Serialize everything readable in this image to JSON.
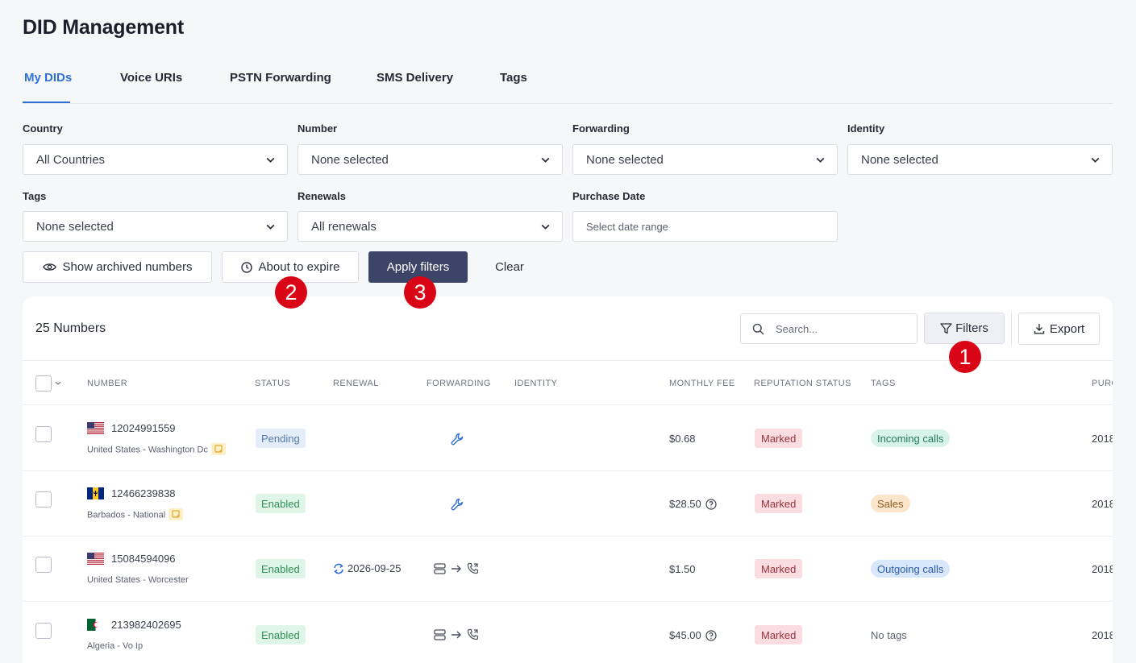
{
  "page_title": "DID Management",
  "tabs": [
    {
      "label": "My DIDs",
      "active": true
    },
    {
      "label": "Voice URIs"
    },
    {
      "label": "PSTN Forwarding"
    },
    {
      "label": "SMS Delivery"
    },
    {
      "label": "Tags"
    }
  ],
  "filters": {
    "country": {
      "label": "Country",
      "value": "All Countries"
    },
    "number": {
      "label": "Number",
      "value": "None selected"
    },
    "forwarding": {
      "label": "Forwarding",
      "value": "None selected"
    },
    "identity": {
      "label": "Identity",
      "value": "None selected"
    },
    "tags": {
      "label": "Tags",
      "value": "None selected"
    },
    "renewals": {
      "label": "Renewals",
      "value": "All renewals"
    },
    "purchase_date": {
      "label": "Purchase Date",
      "placeholder": "Select date range"
    }
  },
  "actions": {
    "show_archived": "Show archived numbers",
    "about_to_expire": "About to expire",
    "apply_filters": "Apply filters",
    "clear": "Clear"
  },
  "callouts": [
    "1",
    "2",
    "3"
  ],
  "table": {
    "count_label": "25 Numbers",
    "search_placeholder": "Search...",
    "filters_label": "Filters",
    "export_label": "Export",
    "columns": [
      "NUMBER",
      "STATUS",
      "RENEWAL",
      "FORWARDING",
      "IDENTITY",
      "MONTHLY FEE",
      "REPUTATION STATUS",
      "TAGS",
      "PURC"
    ],
    "rows": [
      {
        "number": "12024991559",
        "location": "United States - Washington Dc",
        "flag": "us",
        "has_note": true,
        "status": "Pending",
        "renewal": "",
        "forwarding": "wrench",
        "fee": "$0.68",
        "fee_info": false,
        "reputation": "Marked",
        "tag": "Incoming calls",
        "tag_style": "green",
        "purchase": "2018"
      },
      {
        "number": "12466239838",
        "location": "Barbados - National",
        "flag": "bb",
        "has_note": true,
        "status": "Enabled",
        "renewal": "",
        "forwarding": "wrench",
        "fee": "$28.50",
        "fee_info": true,
        "reputation": "Marked",
        "tag": "Sales",
        "tag_style": "orange",
        "purchase": "2018"
      },
      {
        "number": "15084594096",
        "location": "United States - Worcester",
        "flag": "us",
        "has_note": false,
        "status": "Enabled",
        "renewal": "2026-09-25",
        "forwarding": "server-to-phone",
        "fee": "$1.50",
        "fee_info": false,
        "reputation": "Marked",
        "tag": "Outgoing calls",
        "tag_style": "blue",
        "purchase": "2018"
      },
      {
        "number": "213982402695",
        "location": "Algeria - Vo Ip",
        "flag": "dz",
        "has_note": false,
        "status": "Enabled",
        "renewal": "",
        "forwarding": "server-to-phone",
        "fee": "$45.00",
        "fee_info": true,
        "reputation": "Marked",
        "tag": "No tags",
        "tag_style": "none",
        "purchase": "2018"
      }
    ]
  },
  "colors": {
    "accent": "#2f6fd6",
    "primary_button": "#3c4468",
    "callout": "#d90416"
  }
}
